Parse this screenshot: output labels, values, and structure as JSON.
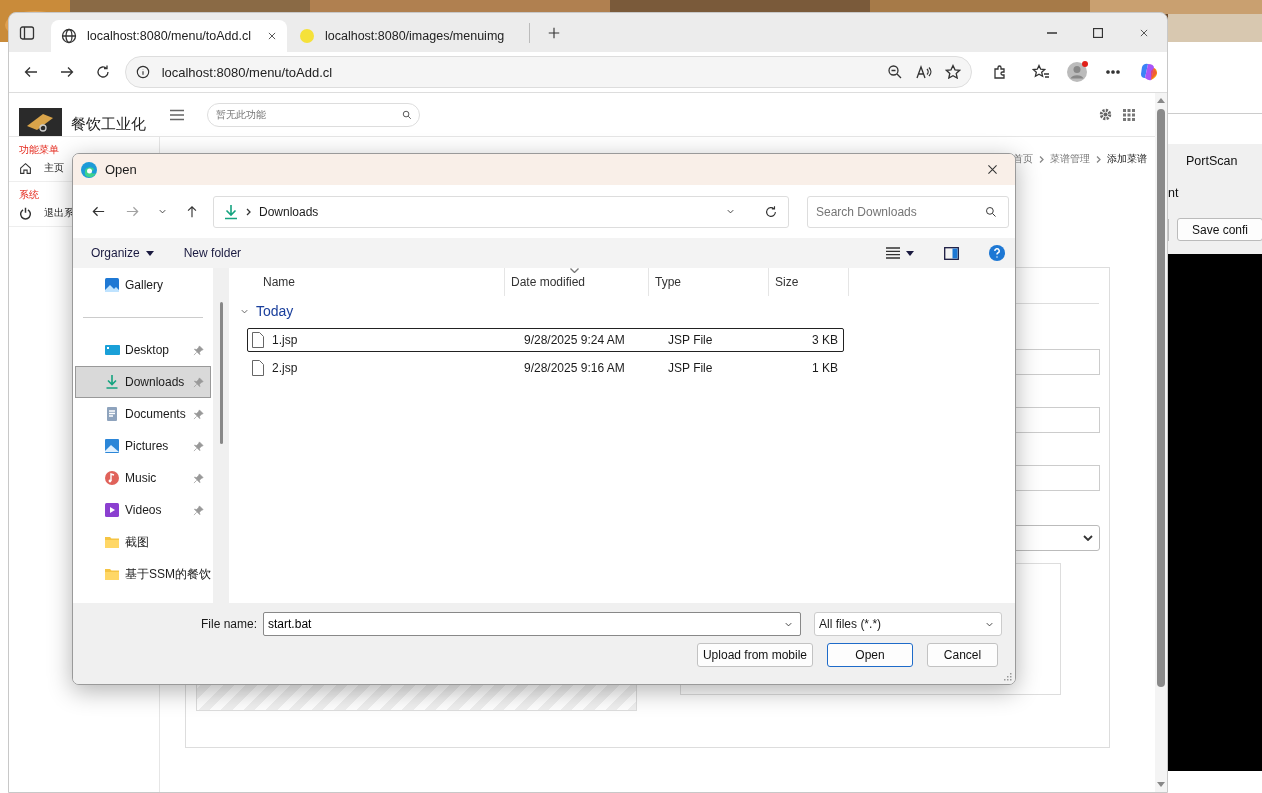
{
  "browser": {
    "tabs": [
      {
        "title": "localhost:8080/menu/toAdd.cl",
        "selected": true
      },
      {
        "title": "localhost:8080/images/menuimg",
        "selected": false
      }
    ],
    "address": "localhost:8080/menu/toAdd.cl"
  },
  "app": {
    "title": "餐饮工业化",
    "search_placeholder": "暂无此功能",
    "sidebar": [
      {
        "kind": "heading",
        "label": "功能菜单"
      },
      {
        "kind": "item",
        "label": "主页"
      },
      {
        "kind": "heading",
        "label": "系统"
      },
      {
        "kind": "item",
        "label": "退出系"
      }
    ],
    "breadcrumb": [
      "首页",
      "菜谱管理",
      "添加菜谱"
    ]
  },
  "dialog": {
    "title": "Open",
    "location": "Downloads",
    "search_placeholder": "Search Downloads",
    "commands": [
      "Organize",
      "New folder"
    ],
    "nav": [
      {
        "label": "Gallery",
        "pinned": false,
        "selected": false
      },
      {
        "label": "Desktop",
        "pinned": true,
        "selected": false
      },
      {
        "label": "Downloads",
        "pinned": true,
        "selected": true
      },
      {
        "label": "Documents",
        "pinned": true,
        "selected": false
      },
      {
        "label": "Pictures",
        "pinned": true,
        "selected": false
      },
      {
        "label": "Music",
        "pinned": true,
        "selected": false
      },
      {
        "label": "Videos",
        "pinned": true,
        "selected": false
      },
      {
        "label": "截图",
        "pinned": false,
        "selected": false
      },
      {
        "label": "基于SSM的餐饮",
        "pinned": false,
        "selected": false
      }
    ],
    "columns": [
      "Name",
      "Date modified",
      "Type",
      "Size"
    ],
    "group": "Today",
    "files": [
      {
        "name": "1.jsp",
        "date": "9/28/2025 9:24 AM",
        "type": "JSP File",
        "size": "3 KB",
        "focused": true
      },
      {
        "name": "2.jsp",
        "date": "9/28/2025 9:16 AM",
        "type": "JSP File",
        "size": "1 KB",
        "focused": false
      }
    ],
    "file_name_label": "File name:",
    "file_name": "start.bat",
    "filter": "All files (*.*)",
    "buttons": [
      {
        "label": "Upload from mobile",
        "default": false
      },
      {
        "label": "Open",
        "default": true
      },
      {
        "label": "Cancel",
        "default": false
      }
    ]
  },
  "side_window": {
    "tab": "PortScan",
    "label": "nt",
    "button": "Save confi"
  }
}
